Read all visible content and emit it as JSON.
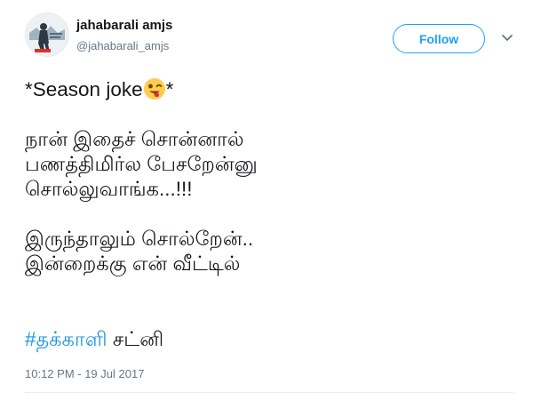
{
  "user": {
    "display_name": "jahabarali amjs",
    "handle": "@jahabarali_amjs"
  },
  "follow_button": {
    "label": "Follow"
  },
  "menu": {
    "icon": "chevron-down-icon"
  },
  "tweet": {
    "line_1_text": "*Season joke",
    "line_1_emoji": "winking-face-with-tongue-emoji",
    "line_1_suffix": "*",
    "line_2": "நான் இதைச் சொன்னால்",
    "line_3": "பணத்திமிர்ல பேசறேன்னு",
    "line_4": "சொல்லுவாங்க...!!!",
    "line_5": "இருந்தாலும் சொல்றேன்..",
    "line_6": "இன்றைக்கு என் வீட்டில்",
    "hashtag": "#தக்காளி",
    "hashtag_tail": " சட்னி"
  },
  "timestamp": "10:12 PM - 19 Jul 2017",
  "colors": {
    "accent": "#1da1f2",
    "hashtag": "#1b95e0",
    "secondary_text": "#657786",
    "primary_text": "#14171a",
    "divider": "#e6ecf0"
  }
}
